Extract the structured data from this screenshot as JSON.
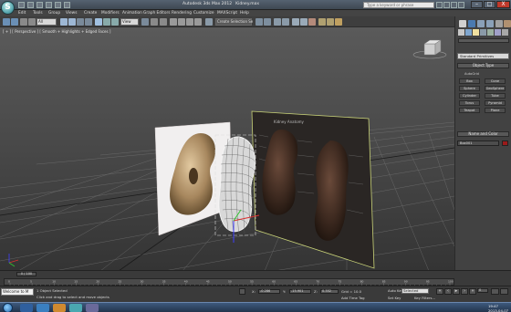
{
  "titlebar": {
    "title_parts": [
      "Autodesk 3ds Max 2012",
      "Kidney.max"
    ],
    "search_placeholder": "Type a keyword or phrase",
    "min_label": "–",
    "max_label": "□",
    "close_label": "X"
  },
  "menu": [
    "Edit",
    "Tools",
    "Group",
    "Views",
    "Create",
    "Modifiers",
    "Animation",
    "Graph Editors",
    "Rendering",
    "Customize",
    "MAXScript",
    "Help"
  ],
  "toolbar": {
    "filter_select": "All",
    "coord_select": "View",
    "selset_select": "Create Selection Se"
  },
  "viewport": {
    "label": "[ + ] [ Perspective ] [ Smooth + Highlights + Edged Faces ]",
    "panel_title": "Kidney Anatomy"
  },
  "command_panel": {
    "category_select": "Standard Primitives",
    "object_type_header": "Object Type",
    "autogrid_label": "AutoGrid",
    "buttons": [
      "Box",
      "Cone",
      "Sphere",
      "GeoSphere",
      "Cylinder",
      "Tube",
      "Torus",
      "Pyramid",
      "Teapot",
      "Plane"
    ],
    "name_color_header": "Name and Color",
    "name_value": "Box001"
  },
  "timeline": {
    "frame_counter": "0 / 100",
    "ticks": [
      "0",
      "5",
      "10",
      "15",
      "20",
      "25",
      "30",
      "35",
      "40",
      "45",
      "50",
      "55",
      "60",
      "65",
      "70",
      "75",
      "80",
      "85",
      "90",
      "95",
      "100"
    ]
  },
  "statusbar": {
    "maxscript_value": "Welcome to M",
    "line1": "1 Object Selected",
    "line2": "Click and drag to select and move objects",
    "x_label": "X:",
    "x_value": "-0.286",
    "y_label": "Y:",
    "y_value": "-15.901",
    "z_label": "Z:",
    "z_value": "0.352",
    "grid_value": "Grid = 10.0",
    "add_time_tag": "Add Time Tag",
    "autokey_label": "Auto Key",
    "setkey_label": "Set Key",
    "selected_select": "Selected",
    "key_filters_label": "Key Filters...",
    "frame_value": "0"
  },
  "taskbar": {
    "time": "19:47",
    "date": "2013-04-07"
  }
}
